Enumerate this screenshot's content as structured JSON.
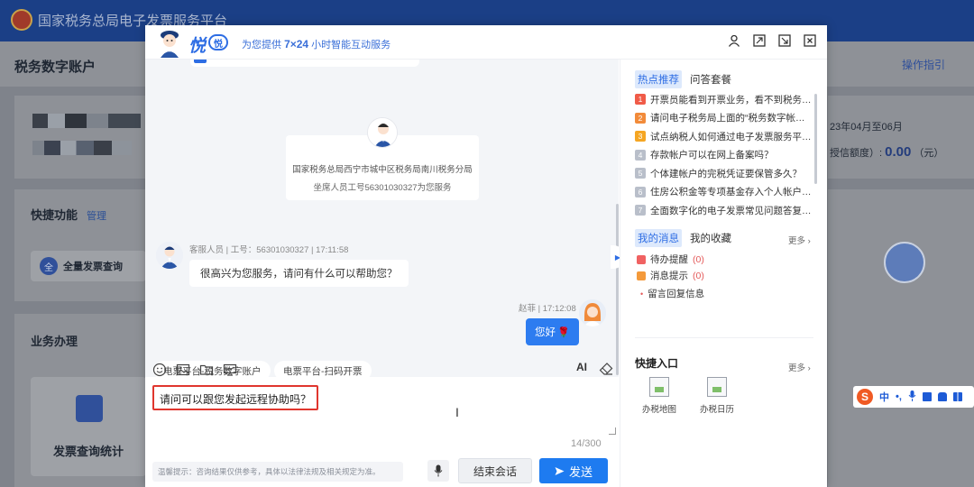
{
  "portal": {
    "site_title": "国家税务总局电子发票服务平台",
    "account_title": "税务数字账户",
    "guide_link": "操作指引",
    "quick_func": "快捷功能",
    "manage": "管理",
    "quick_query": "全量发票查询",
    "business": "业务办理",
    "tile_label": "发票查询统计",
    "date_range": "23年04月至06月",
    "credit_label": "授信额度）:",
    "credit_value": "0.00",
    "credit_unit": "（元）"
  },
  "ime": {
    "logo": "S",
    "lang": "中",
    "punct": "•,",
    "mic": "🎤",
    "kb": "⌨",
    "shirt": "👕"
  },
  "dialog": {
    "brand": "悦",
    "brand_badge": "悦",
    "slogan_prefix": "为您提供 ",
    "slogan_bold": "7×24",
    "slogan_suffix": " 小时智能互动服务"
  },
  "chat": {
    "agent_org": "国家税务总局西宁市城中区税务局南川税务分局",
    "agent_seat": "坐席人员工号56301030327为您服务",
    "agent_meta": "客服人员 | 工号：56301030327 | 17:11:58",
    "agent_greeting": "很高兴为您服务，请问有什么可以帮助您？",
    "user_meta": "赵菲 | 17:12:08",
    "user_message": "您好",
    "user_emoji": "🌹",
    "quick_chips": [
      "电票平台-税务数字账户",
      "电票平台-扫码开票"
    ]
  },
  "input": {
    "text": "请问可以跟您发起远程协助吗？",
    "ai_label": "AI",
    "counter": "14/300",
    "hint": "温馨提示：咨询结果仅供参考，具体以法律法规及相关规定为准。",
    "end_label": "结束会话",
    "send_label": "发送"
  },
  "right": {
    "tabs": [
      "热点推荐",
      "问答套餐"
    ],
    "hot_items": [
      {
        "rank": "1",
        "color": "#f05b48",
        "text": "开票员能看到开票业务，看不到税务…"
      },
      {
        "rank": "2",
        "color": "#f28b3a",
        "text": "请问电子税务局上面的“税务数字帐…"
      },
      {
        "rank": "3",
        "color": "#f5a623",
        "text": "试点纳税人如何通过电子发票服务平…"
      },
      {
        "rank": "4",
        "color": "#b9bfca",
        "text": "存款帐户可以在网上备案吗？"
      },
      {
        "rank": "5",
        "color": "#b9bfca",
        "text": "个体建帐户的完税凭证要保管多久？"
      },
      {
        "rank": "6",
        "color": "#b9bfca",
        "text": "住房公积金等专项基金存入个人帐户…"
      },
      {
        "rank": "7",
        "color": "#b9bfca",
        "text": "全面数字化的电子发票常见问题答复…"
      }
    ],
    "msg_tabs": [
      "我的消息",
      "我的收藏"
    ],
    "more": "更多 ›",
    "messages": [
      {
        "label": "待办提醒",
        "count": "(0)"
      },
      {
        "label": "消息提示",
        "count": "(0)"
      },
      {
        "label": "留言回复信息",
        "count": ""
      }
    ],
    "entry_title": "快捷入口",
    "entries": [
      "办税地图",
      "办税日历"
    ]
  }
}
